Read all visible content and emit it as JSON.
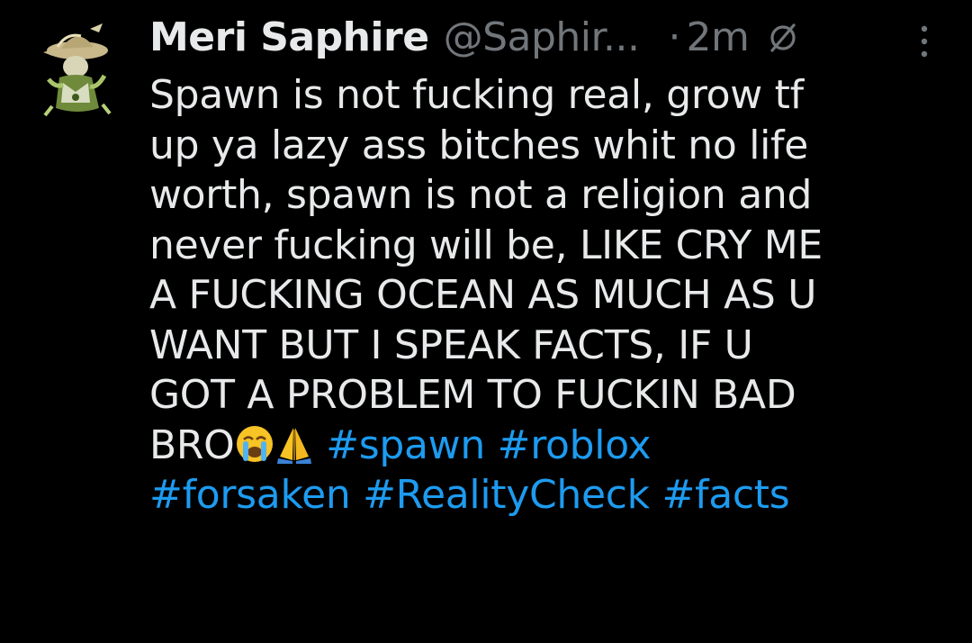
{
  "tweet": {
    "display_name": "Meri Saphire",
    "handle": "@Saphir...",
    "separator": "·",
    "timestamp": "2m",
    "avatar_icon": "avatar-image",
    "edited_icon": "no-reply-icon",
    "more_icon": "more-options-icon",
    "text_lines": [
      "Spawn is not fucking real, grow tf",
      "up ya lazy ass bitches whit no life",
      "worth, spawn is not a religion and",
      "never fucking will be, LIKE CRY ME",
      "A FUCKING OCEAN AS MUCH AS U",
      "WANT BUT I SPEAK FACTS, IF U",
      "GOT A PROBLEM TO FUCKIN BAD"
    ],
    "last_line_text": "BRO",
    "emojis": [
      "crying-face",
      "folded-hands"
    ],
    "hashtags_line1": "#spawn #roblox",
    "hashtags_line2": "#forsaken #RealityCheck #facts"
  },
  "colors": {
    "background": "#000000",
    "text": "#e7e9ea",
    "muted": "#71767b",
    "link": "#1d9bf0"
  }
}
